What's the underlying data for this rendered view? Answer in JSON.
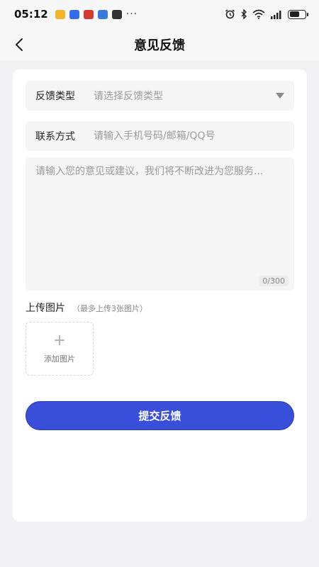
{
  "status_bar": {
    "time": "05:12",
    "overflow": "···",
    "notification_icons": [
      "mail-app-icon",
      "browser-app-icon",
      "news-app-icon",
      "calendar-app-icon",
      "media-app-icon"
    ],
    "system_icons": [
      "alarm-icon",
      "bluetooth-icon",
      "wifi-icon",
      "signal-icon",
      "battery-icon"
    ],
    "battery_level": 0.65
  },
  "nav": {
    "title": "意见反馈",
    "back_icon": "chevron-left-icon"
  },
  "form": {
    "type_field": {
      "label": "反馈类型",
      "placeholder": "请选择反馈类型"
    },
    "contact_field": {
      "label": "联系方式",
      "placeholder": "请输入手机号码/邮箱/QQ号"
    },
    "content_field": {
      "placeholder": "请输入您的意见或建议，我们将不断改进为您服务...",
      "counter": "0/300"
    },
    "upload": {
      "title": "上传图片",
      "hint": "（最多上传3张图片）",
      "add_icon": "+",
      "add_label": "添加图片"
    },
    "submit_label": "提交反馈"
  },
  "colors": {
    "primary": "#3a4fd9",
    "page_background": "#f2f2f4",
    "card_background": "#ffffff",
    "field_background": "#f5f5f5",
    "placeholder_text": "#9a9a9a"
  }
}
